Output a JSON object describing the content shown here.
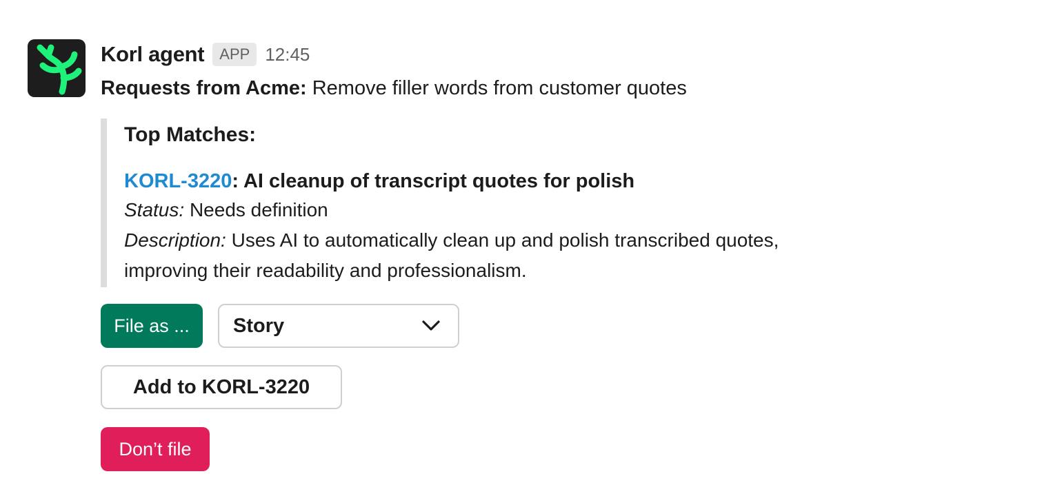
{
  "message": {
    "sender": "Korl agent",
    "badge": "APP",
    "time": "12:45",
    "avatar_icon": "korl-coral-logo",
    "request_prefix": "Requests from Acme:",
    "request_text": " Remove filler words from customer quotes"
  },
  "attachment": {
    "heading": "Top Matches:",
    "ticket_id": "KORL-3220",
    "ticket_separator": ":",
    "ticket_title": " AI cleanup of transcript quotes for polish",
    "status_label": "Status:",
    "status_value": " Needs definition",
    "description_label": "Description:",
    "description_value": " Uses AI to automatically clean up and polish transcribed quotes, improving their readability and professionalism."
  },
  "actions": {
    "file_as_label": "File as ...",
    "type_select_value": "Story",
    "add_to_label": "Add to KORL-3220",
    "dont_file_label": "Don’t file"
  },
  "colors": {
    "primary_button": "#007a5a",
    "danger_button": "#e01e5a",
    "link": "#1d8ad1",
    "logo_green": "#1ff27a"
  }
}
